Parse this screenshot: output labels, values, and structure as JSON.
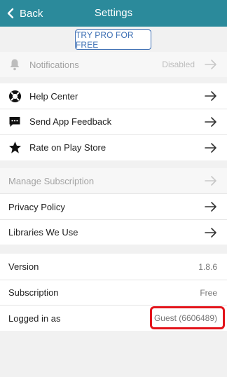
{
  "header": {
    "back_label": "Back",
    "title": "Settings"
  },
  "promo": {
    "button_label": "TRY PRO FOR FREE"
  },
  "notifications": {
    "label": "Notifications",
    "value": "Disabled"
  },
  "support": [
    {
      "label": "Help Center",
      "icon": "help-lifebuoy-icon"
    },
    {
      "label": "Send App Feedback",
      "icon": "chat-icon"
    },
    {
      "label": "Rate on Play Store",
      "icon": "star-icon"
    }
  ],
  "account": [
    {
      "label": "Manage Subscription",
      "disabled": true
    },
    {
      "label": "Privacy Policy"
    },
    {
      "label": "Libraries We Use"
    }
  ],
  "info": [
    {
      "label": "Version",
      "value": "1.8.6"
    },
    {
      "label": "Subscription",
      "value": "Free"
    },
    {
      "label": "Logged in as",
      "value": "Guest (6606489)"
    }
  ],
  "colors": {
    "header_bg": "#2b8a9b",
    "accent": "#3d6fb4",
    "highlight": "#e3141b"
  }
}
